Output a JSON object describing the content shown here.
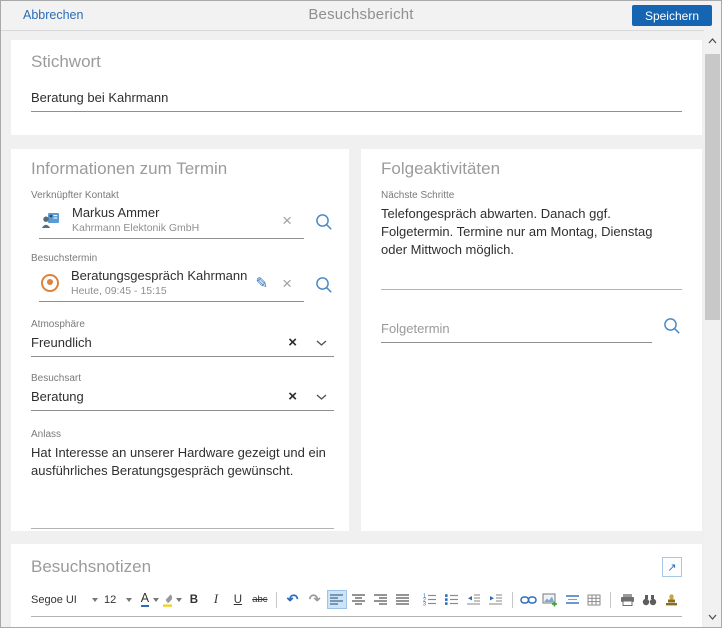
{
  "header": {
    "cancel_label": "Abbrechen",
    "title": "Besuchsbericht",
    "save_label": "Speichern"
  },
  "stichwort": {
    "heading": "Stichwort",
    "value": "Beratung bei Kahrmann"
  },
  "termin": {
    "heading": "Informationen zum Termin",
    "kontakt": {
      "label": "Verknüpfter Kontakt",
      "name": "Markus Ammer",
      "company": "Kahrmann Elektonik GmbH",
      "icons": [
        "contact-card-icon",
        "clear-icon",
        "search-icon"
      ]
    },
    "besuchstermin": {
      "label": "Besuchstermin",
      "title": "Beratungsgespräch Kahrmann",
      "time": "Heute, 09:45 - 15:15",
      "icons": [
        "appointment-icon",
        "edit-icon",
        "clear-icon",
        "search-icon"
      ]
    },
    "atmosphaere": {
      "label": "Atmosphäre",
      "value": "Freundlich",
      "icons": [
        "clear-icon",
        "chevron-down-icon"
      ]
    },
    "besuchsart": {
      "label": "Besuchsart",
      "value": "Beratung",
      "icons": [
        "clear-icon",
        "chevron-down-icon"
      ]
    },
    "anlass": {
      "label": "Anlass",
      "value": "Hat Interesse an unserer Hardware gezeigt und ein ausführliches Beratungsgespräch gewünscht."
    }
  },
  "folge": {
    "heading": "Folgeaktivitäten",
    "naechste_schritte": {
      "label": "Nächste Schritte",
      "value": "Telefongespräch abwarten. Danach ggf. Folgetermin. Termine nur am Montag, Dienstag oder Mittwoch möglich."
    },
    "folgetermin": {
      "placeholder": "Folgetermin",
      "icons": [
        "search-icon"
      ]
    }
  },
  "notizen": {
    "heading": "Besuchsnotizen",
    "open_icon": "open-in-new-icon",
    "toolbar": {
      "font_name": "Segoe UI",
      "font_size": "12",
      "color_label": "A",
      "bold_label": "B",
      "italic_label": "I",
      "underline_label": "U",
      "strike_label": "abc",
      "icon_buttons": [
        "font-color",
        "highlight",
        "bold",
        "italic",
        "underline",
        "strikethrough",
        "undo",
        "redo",
        "align-left",
        "align-center",
        "align-right",
        "justify",
        "numbered-list",
        "bullet-list",
        "outdent",
        "indent",
        "insert-link",
        "insert-image",
        "line-spacing",
        "insert-table",
        "print",
        "find",
        "stamp"
      ],
      "selected_button": "align-left"
    }
  },
  "colors": {
    "accent_blue": "#1565b2",
    "link_blue": "#2b6cb5",
    "icon_blue": "#2a6dbf",
    "appointment_orange": "#e0813a",
    "highlight_yellow": "#f2d10c"
  }
}
